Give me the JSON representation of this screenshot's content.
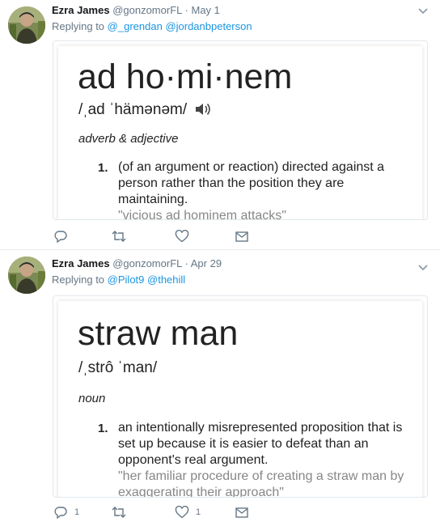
{
  "tweets": [
    {
      "author_name": "Ezra James",
      "handle": "@gonzomorFL",
      "separator": "·",
      "date": "May 1",
      "replying_prefix": "Replying to",
      "reply_handles": [
        "@_grendan",
        "@jordanbpeterson"
      ],
      "card": {
        "headword": "ad ho·mi·nem",
        "pronunciation": "/ˌad ˈhämənəm/",
        "part_of_speech": "adverb & adjective",
        "def_number": "1.",
        "definition": "(of an argument or reaction) directed against a person rather than the position they are maintaining.",
        "example": "\"vicious ad hominem attacks\""
      },
      "actions": {
        "reply_count": "",
        "retweet_count": "",
        "like_count": ""
      }
    },
    {
      "author_name": "Ezra James",
      "handle": "@gonzomorFL",
      "separator": "·",
      "date": "Apr 29",
      "replying_prefix": "Replying to",
      "reply_handles": [
        "@Pilot9",
        "@thehill"
      ],
      "card": {
        "headword": "straw man",
        "pronunciation": "/ˌstrô ˈman/",
        "part_of_speech": "noun",
        "def_number": "1.",
        "definition": "an intentionally misrepresented proposition that is set up because it is easier to defeat than an opponent's real argument.",
        "example": "\"her familiar procedure of creating a straw man by exaggerating their approach\""
      },
      "actions": {
        "reply_count": "1",
        "retweet_count": "",
        "like_count": "1"
      }
    }
  ],
  "icons": {
    "reply": "reply-icon",
    "retweet": "retweet-icon",
    "like": "heart-icon",
    "dm": "envelope-icon",
    "more": "chevron-down-icon",
    "audio": "speaker-icon"
  },
  "colors": {
    "link": "#1b95e0",
    "muted": "#657786",
    "border": "#e6ecf0"
  }
}
